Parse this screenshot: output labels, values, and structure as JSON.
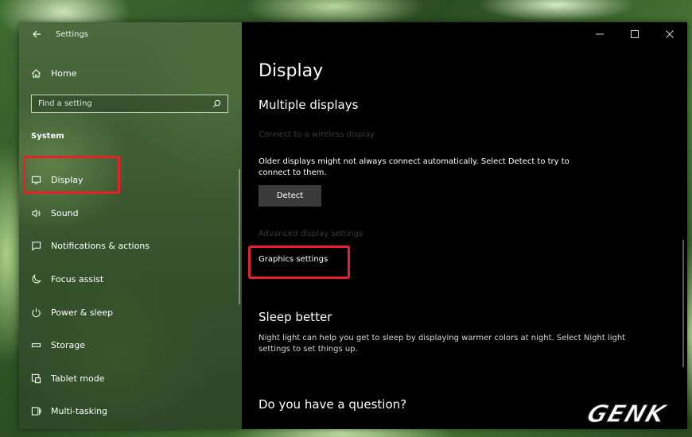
{
  "window": {
    "title": "Settings"
  },
  "sidebar": {
    "home_label": "Home",
    "search_placeholder": "Find a setting",
    "section_label": "System",
    "items": [
      {
        "label": "Display",
        "icon": "monitor-icon",
        "selected": true
      },
      {
        "label": "Sound",
        "icon": "speaker-icon"
      },
      {
        "label": "Notifications & actions",
        "icon": "notification-icon"
      },
      {
        "label": "Focus assist",
        "icon": "moon-icon"
      },
      {
        "label": "Power & sleep",
        "icon": "power-icon"
      },
      {
        "label": "Storage",
        "icon": "storage-icon"
      },
      {
        "label": "Tablet mode",
        "icon": "tablet-mode-icon"
      },
      {
        "label": "Multi-tasking",
        "icon": "multitasking-icon"
      }
    ]
  },
  "window_controls": {
    "minimize": "—",
    "maximize": "☐",
    "close": "✕"
  },
  "main": {
    "page_title": "Display",
    "multiple_displays": {
      "heading": "Multiple displays",
      "wireless_link": "Connect to a wireless display",
      "description": "Older displays might not always connect automatically. Select Detect to try to connect to them.",
      "detect_button": "Detect",
      "advanced_link": "Advanced display settings",
      "graphics_link": "Graphics settings"
    },
    "sleep_better": {
      "heading": "Sleep better",
      "description": "Night light can help you get to sleep by displaying warmer colors at night. Select Night light settings to set things up."
    },
    "question_heading": "Do you have a question?"
  },
  "watermark": {
    "text": "GENK"
  },
  "colors": {
    "highlight": "#e8202a",
    "main_bg": "#000000",
    "button_bg": "#3a3a3a",
    "disabled_text": "#3a3a3a"
  }
}
